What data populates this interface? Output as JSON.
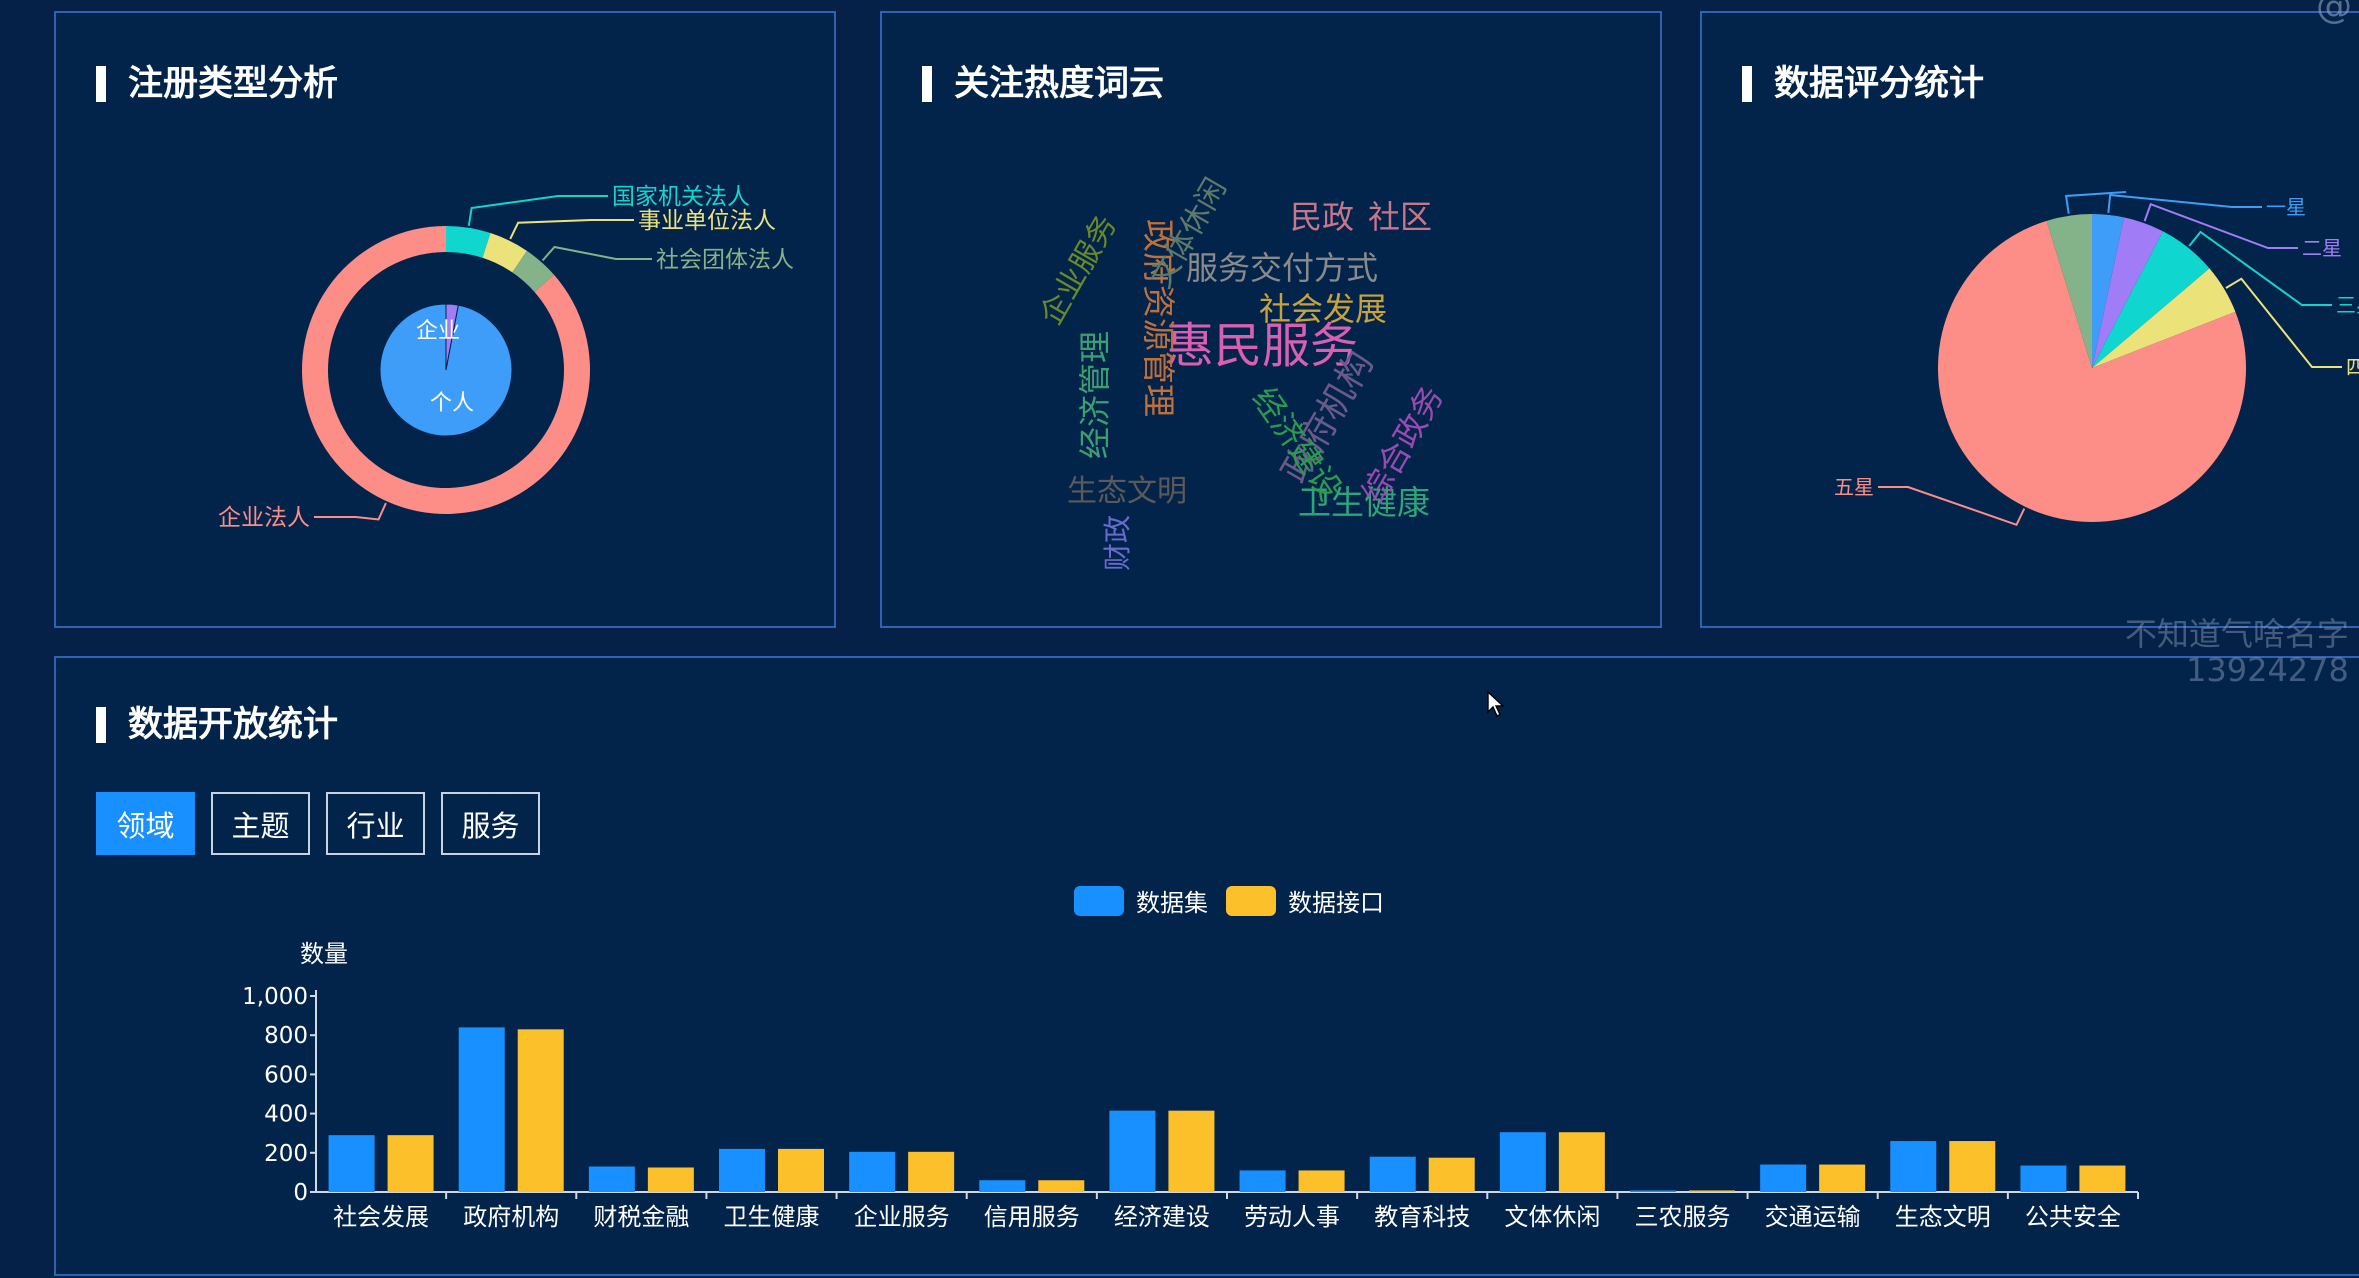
{
  "panels": {
    "register": {
      "title": "注册类型分析",
      "inner_labels": [
        "企业",
        "个人"
      ],
      "outer_labels": [
        "国家机关法人",
        "事业单位法人",
        "社会团体法人",
        "企业法人"
      ]
    },
    "wordcloud": {
      "title": "关注热度词云",
      "words": [
        "企业服务",
        "政府资源管理",
        "文体休闲",
        "民政",
        "社区",
        "服务交付方式",
        "社会发展",
        "惠民服务",
        "经济管理",
        "政府机构",
        "综合政务",
        "经济建设",
        "生态文明",
        "财政",
        "卫生健康"
      ]
    },
    "rating": {
      "title": "数据评分统计",
      "labels": [
        "一星",
        "二星",
        "三星",
        "四星",
        "五星"
      ]
    },
    "open": {
      "title": "数据开放统计",
      "tabs": [
        "领域",
        "主题",
        "行业",
        "服务"
      ],
      "active_tab": "领域"
    }
  },
  "overlay": {
    "corner_tag": "@",
    "watermark_line1": "不知道气啥名字",
    "watermark_line2": "13924278"
  },
  "chart_data": [
    {
      "type": "pie",
      "variant": "nested-donut",
      "inner": [
        {
          "name": "企业",
          "value": 3,
          "color": "#a07cf7"
        },
        {
          "name": "个人",
          "value": 97,
          "color": "#3d9df8"
        }
      ],
      "outer": [
        {
          "name": "国家机关法人",
          "value": 5,
          "color": "#10d6d0"
        },
        {
          "name": "事业单位法人",
          "value": 4.5,
          "color": "#ece27a"
        },
        {
          "name": "社会团体法人",
          "value": 4,
          "color": "#84b289"
        },
        {
          "name": "企业法人",
          "value": 86.5,
          "color": "#fd8e87"
        }
      ]
    },
    {
      "type": "other",
      "variant": "word-cloud",
      "words": [
        {
          "text": "惠民服务",
          "weight": 10,
          "color": "#d95fb0"
        },
        {
          "text": "社会发展",
          "weight": 6,
          "color": "#c8a23a"
        },
        {
          "text": "民政",
          "weight": 5,
          "color": "#c9768a"
        },
        {
          "text": "社区",
          "weight": 5,
          "color": "#c9768a"
        },
        {
          "text": "服务交付方式",
          "weight": 5,
          "color": "#8a8a8a"
        },
        {
          "text": "卫生健康",
          "weight": 5,
          "color": "#2fa37a"
        },
        {
          "text": "政府资源管理",
          "weight": 5,
          "color": "#c0703a"
        },
        {
          "text": "文体休闲",
          "weight": 5,
          "color": "#5d7a6a"
        },
        {
          "text": "企业服务",
          "weight": 5,
          "color": "#6a8a2a"
        },
        {
          "text": "经济管理",
          "weight": 5,
          "color": "#3aa071"
        },
        {
          "text": "政府机构",
          "weight": 6,
          "color": "#6a5a8a"
        },
        {
          "text": "综合政务",
          "weight": 5,
          "color": "#9a4ab0"
        },
        {
          "text": "经济建设",
          "weight": 5,
          "color": "#2d9b4e"
        },
        {
          "text": "生态文明",
          "weight": 5,
          "color": "#5a5a5a"
        },
        {
          "text": "财政",
          "weight": 4,
          "color": "#6a6ad0"
        }
      ]
    },
    {
      "type": "pie",
      "slices": [
        {
          "name": "一星",
          "value": 3.5,
          "color": "#3d9df8"
        },
        {
          "name": "二星",
          "value": 4.5,
          "color": "#a07cf7"
        },
        {
          "name": "三星",
          "value": 6.5,
          "color": "#10d6d0"
        },
        {
          "name": "四星",
          "value": 5.5,
          "color": "#ece27a"
        },
        {
          "name": "五星",
          "value": 80,
          "color": "#fd8e87"
        },
        {
          "name": "",
          "value": 5,
          "color": "#84b289"
        }
      ]
    },
    {
      "type": "bar",
      "categories": [
        "社会发展",
        "政府机构",
        "财税金融",
        "卫生健康",
        "企业服务",
        "信用服务",
        "经济建设",
        "劳动人事",
        "教育科技",
        "文体休闲",
        "三农服务",
        "交通运输",
        "生态文明",
        "公共安全"
      ],
      "series": [
        {
          "name": "数据集",
          "color": "#1890ff",
          "values": [
            290,
            840,
            130,
            220,
            205,
            60,
            415,
            110,
            180,
            305,
            8,
            140,
            260,
            135
          ]
        },
        {
          "name": "数据接口",
          "color": "#fcc02b",
          "values": [
            290,
            830,
            125,
            220,
            205,
            60,
            415,
            110,
            175,
            305,
            8,
            140,
            260,
            135
          ]
        }
      ],
      "ylabel": "数量",
      "ylim": [
        0,
        1000
      ],
      "yticks": [
        "0",
        "200",
        "400",
        "600",
        "800",
        "1,000"
      ],
      "legend": "top-center",
      "grid": false
    }
  ]
}
